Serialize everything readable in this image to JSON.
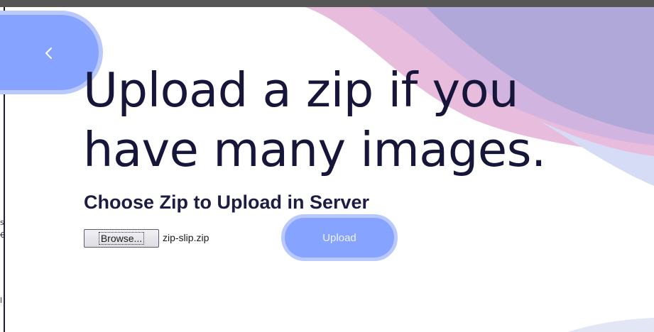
{
  "page": {
    "headline": "Upload a zip if you have many images.",
    "subheading": "Choose Zip to Upload in Server"
  },
  "navigation": {
    "back_icon": "chevron-left-icon"
  },
  "upload_form": {
    "browse_label": "Browse...",
    "selected_file": "zip-slip.zip",
    "upload_label": "Upload"
  },
  "left_edge_glyphs": [
    "s",
    "€",
    "l"
  ],
  "colors": {
    "primary": "#86a4ff",
    "primary_ring": "#b9c9ff",
    "heading": "#16163a",
    "wave_pink": "#e8bcdc",
    "wave_purple": "#b0a8d9",
    "wave_lavender": "#d6dcf5"
  }
}
